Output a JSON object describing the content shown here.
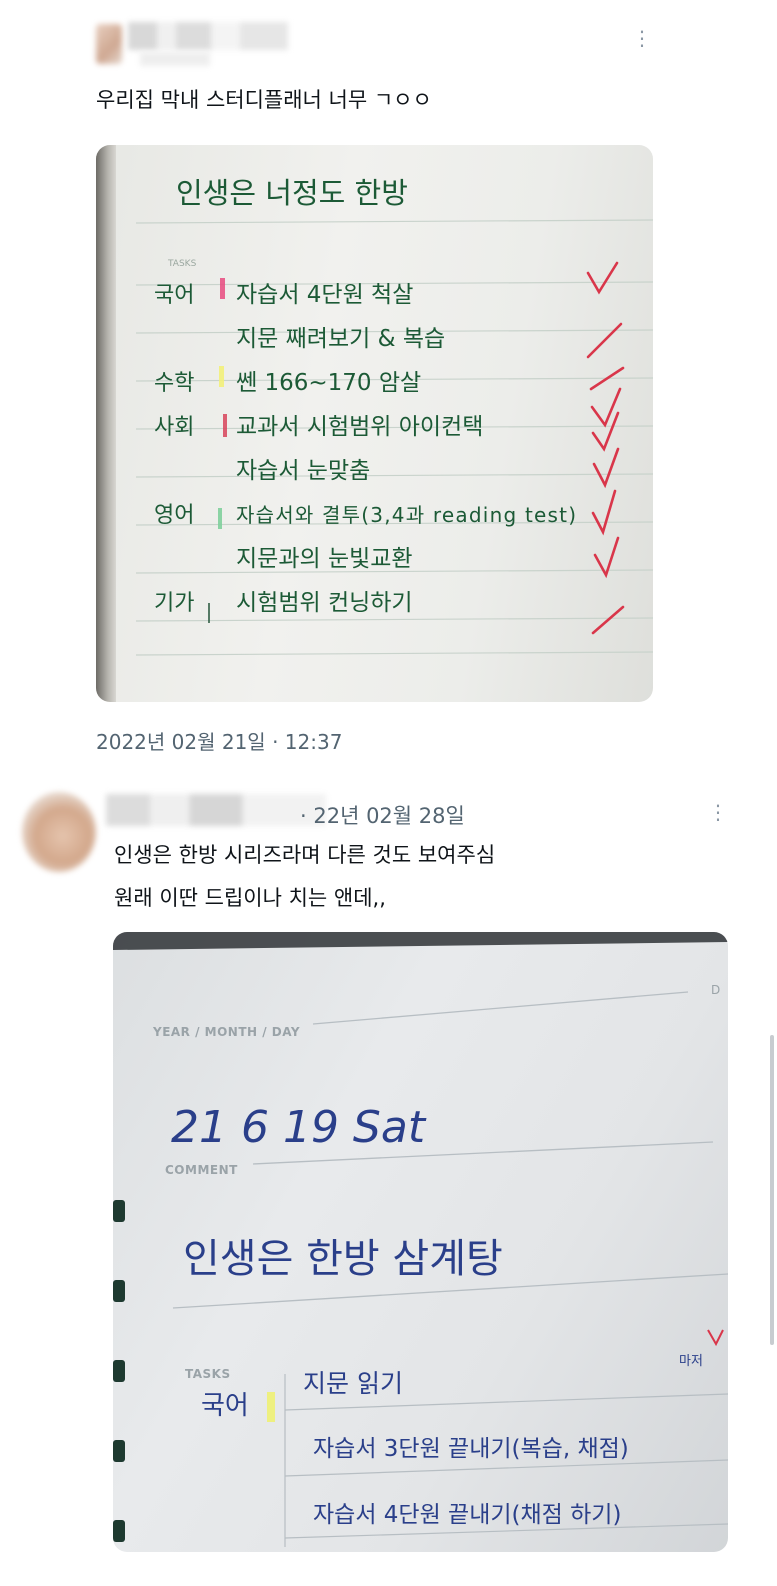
{
  "post1": {
    "text": "우리집 막내 스터디플래너 너무 ㄱㅇㅇ",
    "timestamp": "2022년 02월 21일 · 12:37",
    "more_icon": "more-vertical-icon",
    "photo": {
      "title": "인생은 너정도 한방",
      "tasks_label": "TASKS",
      "rows": [
        {
          "subject": "국어",
          "task": "자습서 4단원 척살"
        },
        {
          "subject": "",
          "task": "지문 째려보기 & 복습"
        },
        {
          "subject": "수학",
          "task": "쎈 166~170 암살"
        },
        {
          "subject": "사회",
          "task": "교과서 시험범위 아이컨택"
        },
        {
          "subject": "",
          "task": "자습서 눈맞춤"
        },
        {
          "subject": "영어",
          "task": "자습서와 결투(3,4과 reading test)"
        },
        {
          "subject": "",
          "task": "지문과의 눈빛교환"
        },
        {
          "subject": "기가",
          "task": "시험범위 컨닝하기"
        }
      ]
    }
  },
  "post2": {
    "date": "· 22년 02월 28일",
    "text_line1": "인생은 한방 시리즈라며 다른 것도 보여주심",
    "text_line2": "원래 이딴 드립이나 치는 앤데,,",
    "more_icon": "more-vertical-icon",
    "photo": {
      "year_month_day_label": "YEAR / MONTH / DAY",
      "date_written": "21 6 19 Sat",
      "comment_label": "COMMENT",
      "comment_written": "인생은 한방 삼계탕",
      "tasks_label": "TASKS",
      "subject": "국어",
      "tasks": [
        "지문 읽기",
        "자습서 3단원 끝내기(복습, 채점)",
        "자습서 4단원 끝내기(채점 하기)"
      ],
      "note": "마저"
    }
  },
  "colors": {
    "pen_green": "#1f5b3a",
    "pen_blue": "#2a3f8a",
    "check_red": "#d9364a",
    "text_secondary": "#536471"
  }
}
